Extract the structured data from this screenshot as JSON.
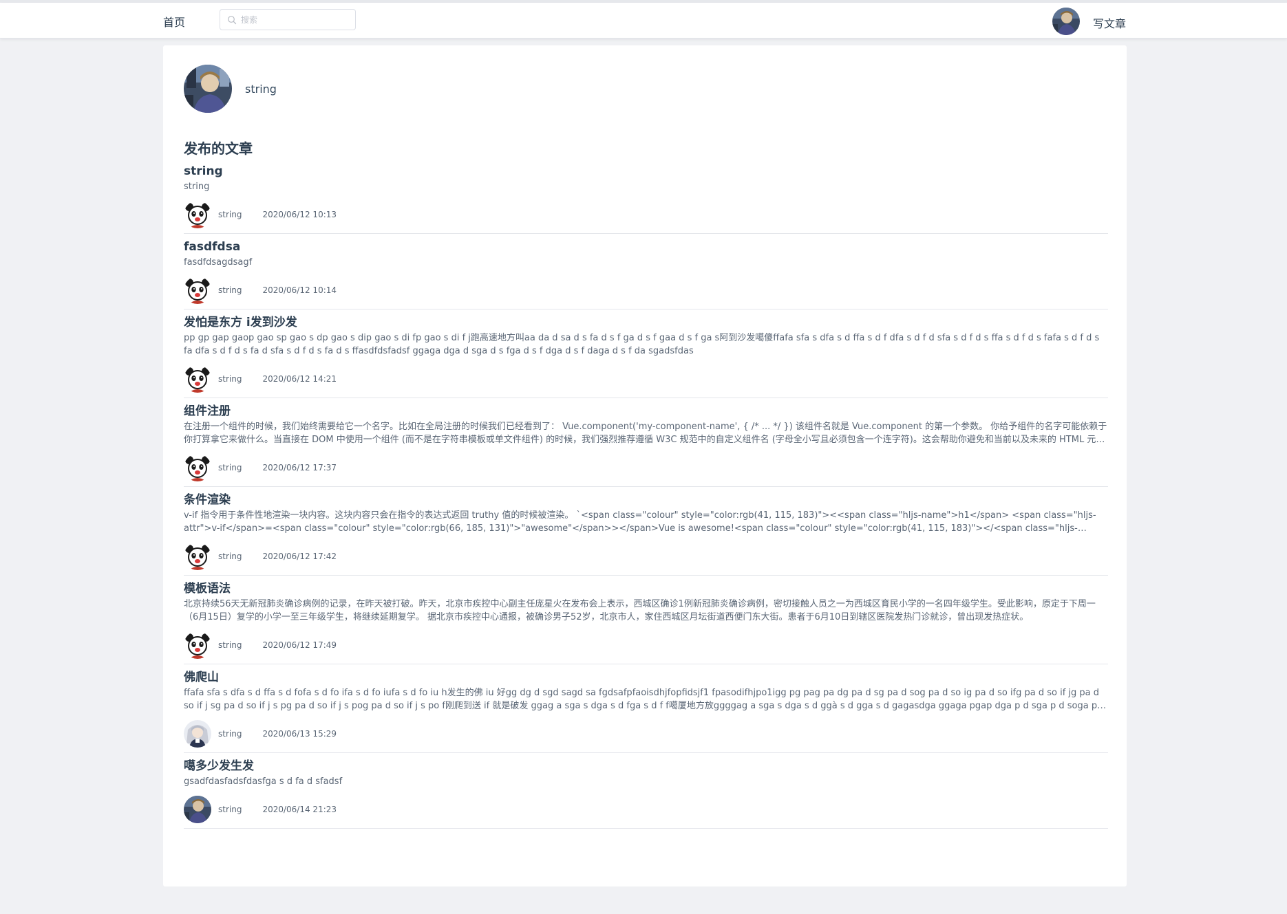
{
  "header": {
    "home_label": "首页",
    "search_placeholder": "搜索",
    "search_value": "",
    "write_label": "写文章"
  },
  "profile": {
    "name": "string"
  },
  "section_title": "发布的文章",
  "articles": [
    {
      "title": "string",
      "summary": "string",
      "author": "string",
      "time": "2020/06/12 10:13",
      "avatar_icon": "cartoon-panda-avatar-icon"
    },
    {
      "title": "fasdfdsa",
      "summary": "fasdfdsagdsagf",
      "author": "string",
      "time": "2020/06/12 10:14",
      "avatar_icon": "cartoon-panda-avatar-icon"
    },
    {
      "title": "发怕是东方 i发到沙发",
      "summary": "pp gp gap gaop gao sp gao s dp gao s dip gao s di fp gao s di f j跑高速地方叫aa da d sa d s fa d s f ga d s f gaa d s f ga s阿到沙发噶傻ffafa sfa s dfa s d ffa s d f dfa s d f d sfa s d f d s ffa s d f d s fafa s d f d s fa dfa s d f d s fa d sfa s d f d s fa d s ffasdfdsfadsf ggaga dga d sga d s fga d s f dga d s f daga d s f da sgadsfdas",
      "author": "string",
      "time": "2020/06/12 14:21",
      "avatar_icon": "cartoon-panda-avatar-icon"
    },
    {
      "title": "组件注册",
      "summary": "在注册一个组件的时候，我们始终需要给它一个名字。比如在全局注册的时候我们已经看到了： Vue.component('my-component-name', { /* ... */ }) 该组件名就是 Vue.component 的第一个参数。 你给予组件的名字可能依赖于你打算拿它来做什么。当直接在 DOM 中使用一个组件 (而不是在字符串模板或单文件组件) 的时候，我们强烈推荐遵循 W3C 规范中的自定义组件名 (字母全小写且必须包含一个连字符)。这会帮助你避免和当前以及未来的 HTML 元素相冲突。",
      "author": "string",
      "time": "2020/06/12 17:37",
      "avatar_icon": "cartoon-panda-avatar-icon"
    },
    {
      "title": "条件渲染",
      "summary": "v-if 指令用于条件性地渲染一块内容。这块内容只会在指令的表达式返回 truthy 值的时候被渲染。 `<span class=\"colour\" style=\"color:rgb(41, 115, 183)\"><<span class=\"hljs-name\">h1</span> <span class=\"hljs-attr\">v-if</span>=<span class=\"colour\" style=\"color:rgb(66, 185, 131)\">\"awesome\"</span>></span>Vue is awesome!<span class=\"colour\" style=\"color:rgb(41, 115, 183)\"></<span class=\"hljs-name\">h1</span>></span>`",
      "author": "string",
      "time": "2020/06/12 17:42",
      "avatar_icon": "cartoon-panda-avatar-icon"
    },
    {
      "title": "模板语法",
      "summary": "北京持续56天无新冠肺炎确诊病例的记录，在昨天被打破。昨天，北京市疾控中心副主任庞星火在发布会上表示，西城区确诊1例新冠肺炎确诊病例，密切接触人员之一为西城区育民小学的一名四年级学生。受此影响，原定于下周一（6月15日）复学的小学一至三年级学生，将继续延期复学。 据北京市疾控中心通报，被确诊男子52岁，北京市人，家住西城区月坛街道西便门东大街。患者于6月10日到辖区医院发热门诊就诊，曾出现发热症状。",
      "author": "string",
      "time": "2020/06/12 17:49",
      "avatar_icon": "cartoon-panda-avatar-icon"
    },
    {
      "title": "佛爬山",
      "summary": "ffafa sfa s dfa s d ffa s d fofa s d fo ifa s d fo iufa s d fo iu h发生的佛 iu 好gg dg d sgd sagd sa fgdsafpfaoisdhjfopfidsjf1 fpasodifhjpo1igg pg pag pa dg pa d sg pa d sog pa d so ig pa d so ifg pa d so if jg pa d so if j sg pa d so if j s pg pa d so if j s pog pa d so if j s po f刚爬到送 if 就是破发 ggag a sga s dga s d fga s d f f噶厦地方放ggggag a sga s dga s d ggà s d gga s d gagasdga ggaga pgap dga p d sga p d soga p d so gga p d so ggaga",
      "author": "string",
      "time": "2020/06/13 15:29",
      "avatar_icon": "anime-character-avatar-icon"
    },
    {
      "title": "噶多少发生发",
      "summary": "gsadfdasfadsfdasfga s d fa d sfadsf",
      "author": "string",
      "time": "2020/06/14 21:23",
      "avatar_icon": "photo-avatar-icon"
    }
  ]
}
